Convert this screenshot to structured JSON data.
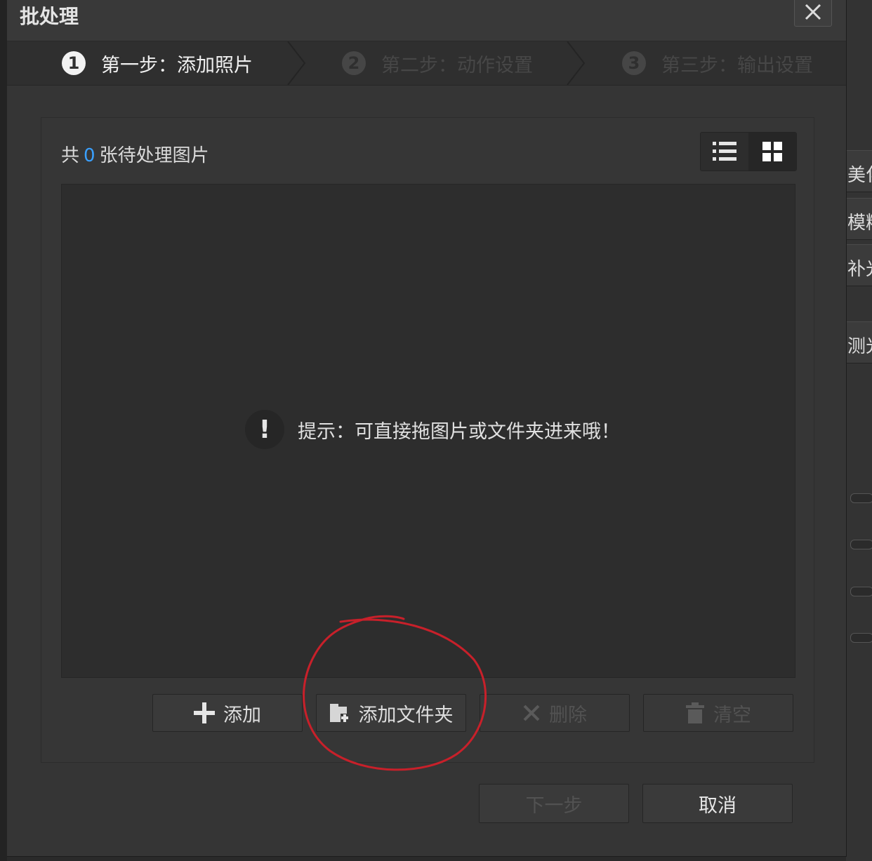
{
  "dialog": {
    "title": "批处理",
    "close_icon": "close-icon"
  },
  "steps": [
    {
      "number": "1",
      "label": "第一步：添加照片",
      "state": "active"
    },
    {
      "number": "2",
      "label": "第二步：动作设置",
      "state": "inactive"
    },
    {
      "number": "3",
      "label": "第三步：输出设置",
      "state": "inactive"
    }
  ],
  "panel": {
    "count_prefix": "共",
    "count_value": "0",
    "count_suffix": "张待处理图片",
    "view_modes": [
      {
        "icon": "list-view-icon",
        "selected": false
      },
      {
        "icon": "grid-view-icon",
        "selected": true
      }
    ],
    "hint_icon": "exclamation-icon",
    "hint_text": "提示：可直接拖图片或文件夹进来哦！"
  },
  "actions": [
    {
      "label": "添加",
      "icon": "plus-icon",
      "enabled": true
    },
    {
      "label": "添加文件夹",
      "icon": "add-folder-icon",
      "enabled": true
    },
    {
      "label": "删除",
      "icon": "x-icon",
      "enabled": false
    },
    {
      "label": "清空",
      "icon": "trash-icon",
      "enabled": false
    }
  ],
  "footer": {
    "next_label": "下一步",
    "next_enabled": false,
    "cancel_label": "取消"
  },
  "background_app": {
    "strip_labels": [
      "美化",
      "模糊",
      "补光",
      "测光"
    ]
  },
  "colors": {
    "accent_count": "#3aa0ff",
    "annotation_circle": "#c8202a"
  }
}
